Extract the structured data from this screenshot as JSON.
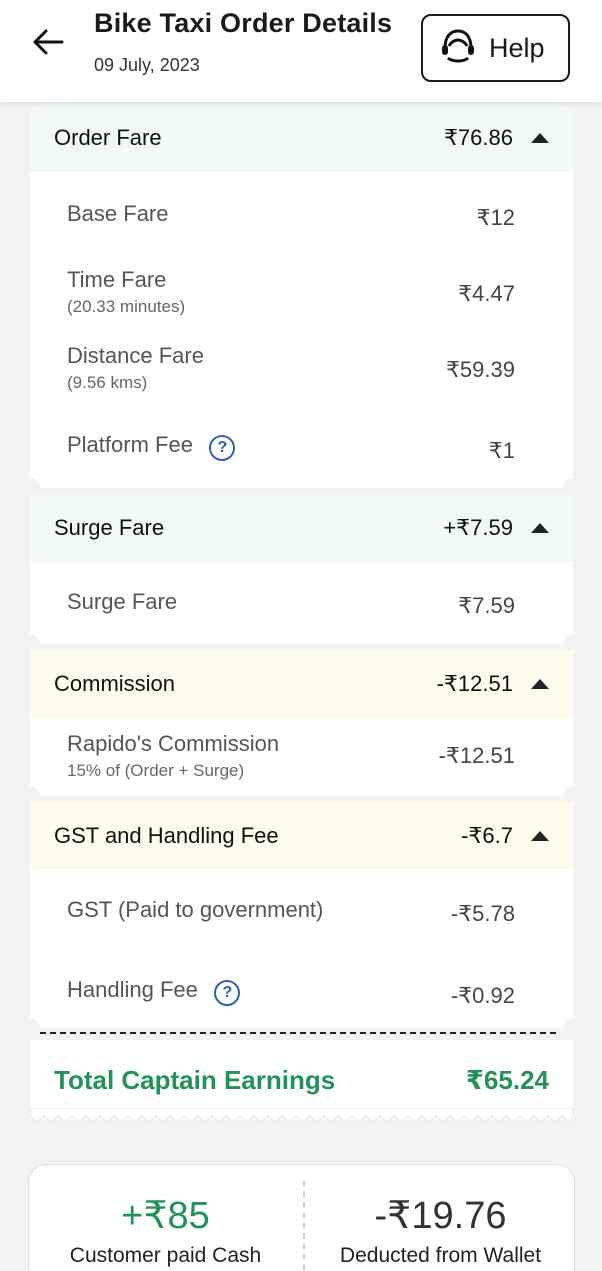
{
  "header": {
    "title": "Bike Taxi Order Details",
    "date": "09 July, 2023",
    "help_label": "Help"
  },
  "order_fare": {
    "title": "Order Fare",
    "amount": "₹76.86",
    "items": [
      {
        "label": "Base Fare",
        "sub": "",
        "value": "₹12"
      },
      {
        "label": "Time Fare",
        "sub": "(20.33 minutes)",
        "value": "₹4.47"
      },
      {
        "label": "Distance Fare",
        "sub": "(9.56 kms)",
        "value": "₹59.39"
      },
      {
        "label": "Platform Fee",
        "sub": "",
        "value": "₹1"
      }
    ]
  },
  "surge": {
    "title": "Surge Fare",
    "amount": "+₹7.59",
    "items": [
      {
        "label": "Surge Fare",
        "value": "₹7.59"
      }
    ]
  },
  "commission": {
    "title": "Commission",
    "amount": "-₹12.51",
    "items": [
      {
        "label": "Rapido's Commission",
        "sub": "15% of (Order + Surge)",
        "value": "-₹12.51"
      }
    ]
  },
  "gst": {
    "title": "GST and Handling Fee",
    "amount": "-₹6.7",
    "items": [
      {
        "label": "GST (Paid to government)",
        "value": "-₹5.78"
      },
      {
        "label": "Handling Fee",
        "value": "-₹0.92"
      }
    ]
  },
  "total": {
    "label": "Total Captain Earnings",
    "value": "₹65.24"
  },
  "summary": {
    "cash_value": "+₹85",
    "cash_label": "Customer paid Cash",
    "wallet_value": "-₹19.76",
    "wallet_label": "Deducted from Wallet"
  },
  "colors": {
    "accent_green": "#23925a",
    "info_blue": "#2f5db8",
    "green_tint": "#f1f8f5",
    "yellow_tint": "#fdfbeb"
  }
}
